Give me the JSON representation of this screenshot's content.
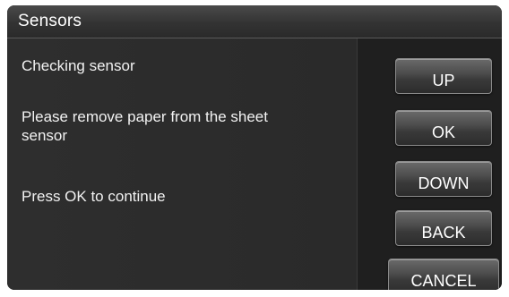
{
  "title_bar": {
    "title": "Sensors"
  },
  "messages": {
    "line1": "Checking sensor",
    "line2": "Please remove paper from the sheet sensor",
    "line3": "Press OK to continue"
  },
  "buttons": {
    "up": "UP",
    "ok": "OK",
    "down": "DOWN",
    "back": "BACK",
    "cancel": "CANCEL"
  },
  "colors": {
    "background": "#262626",
    "text": "#ffffff"
  }
}
